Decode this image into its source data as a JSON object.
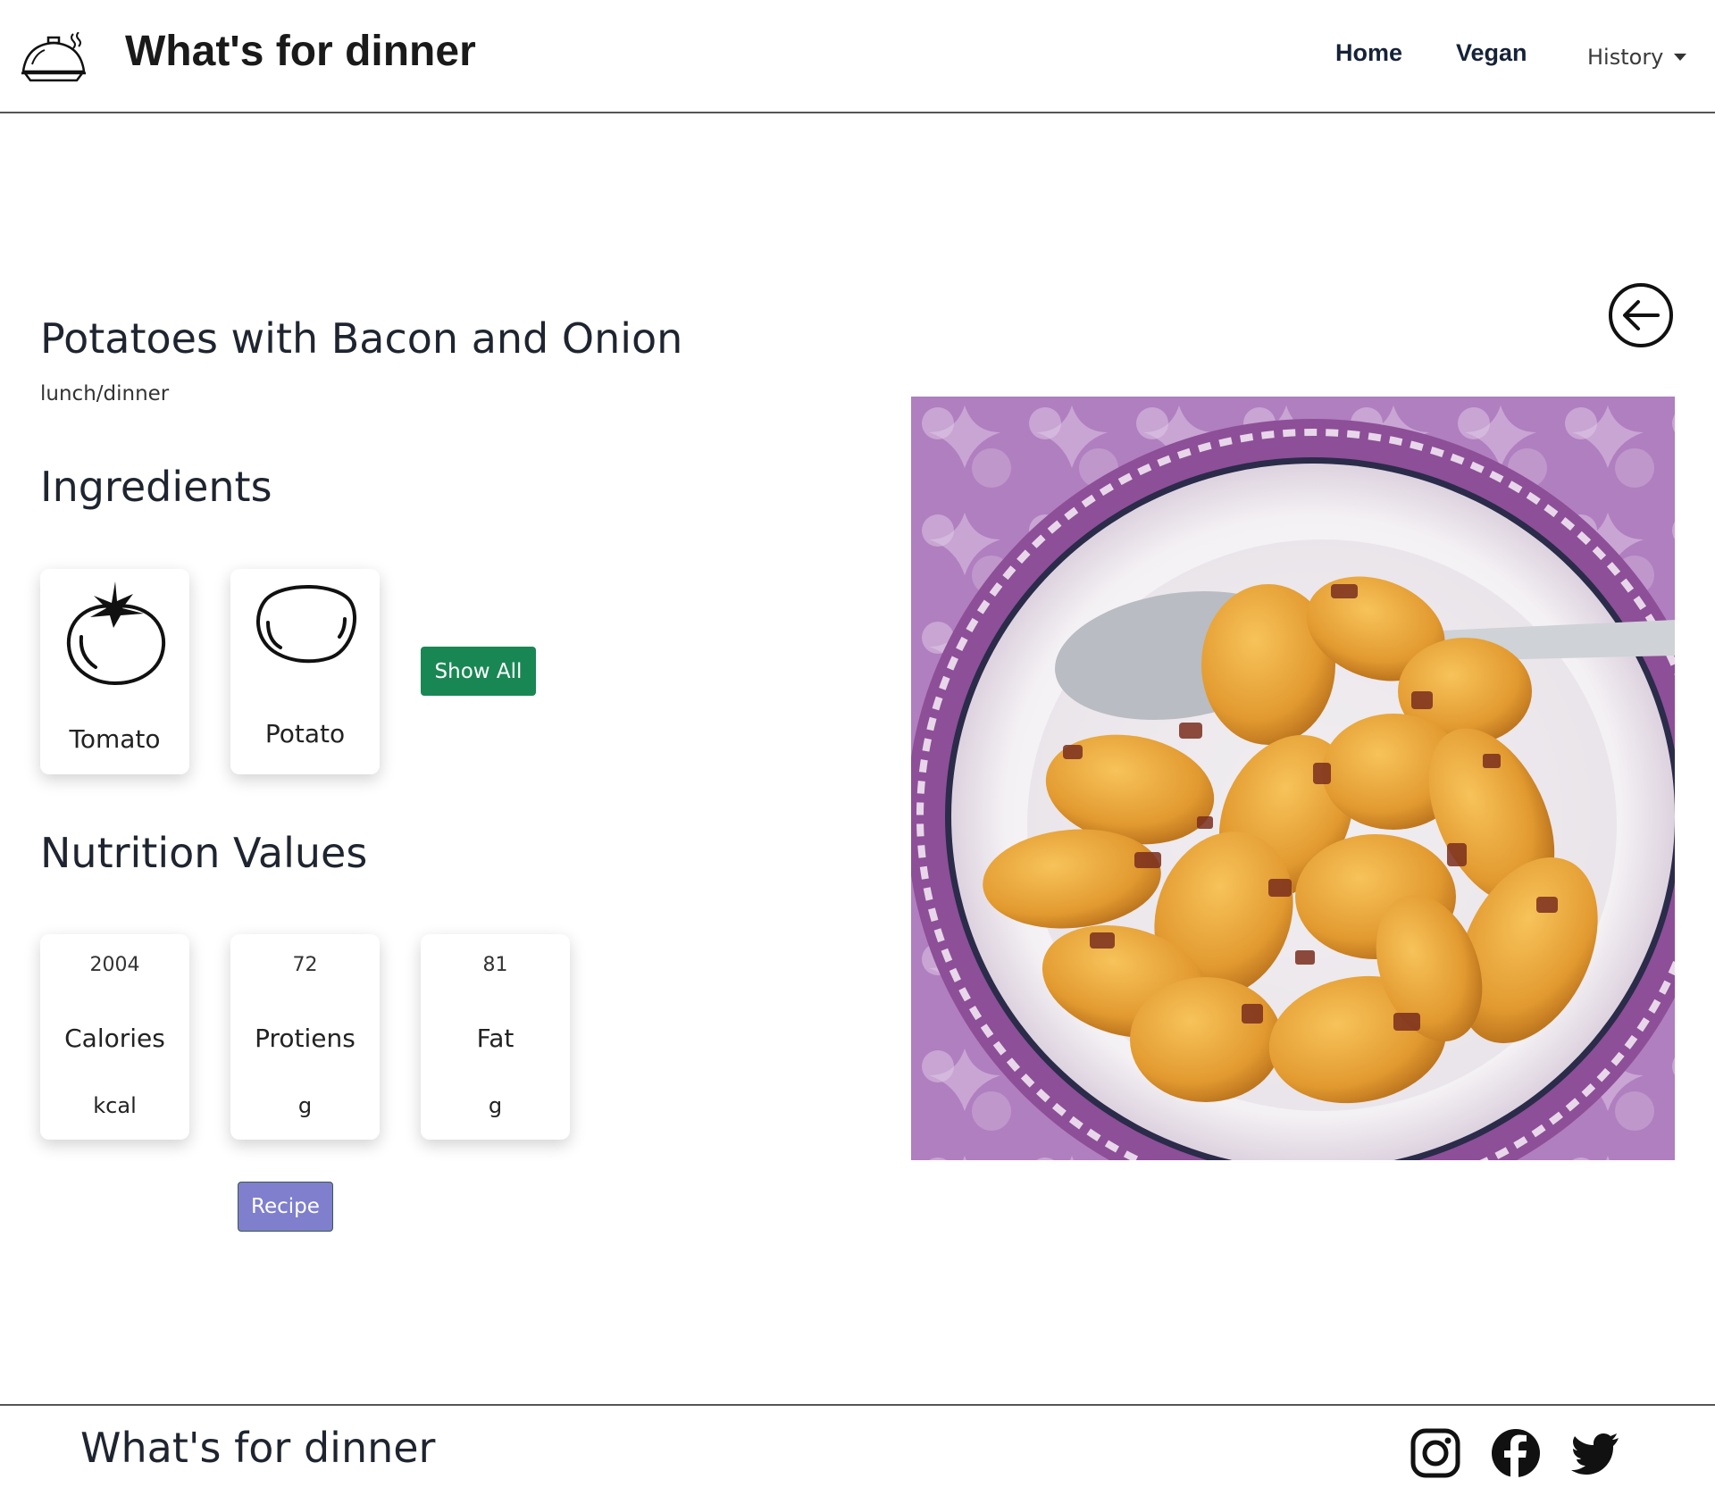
{
  "header": {
    "brand_title": "What's for dinner",
    "nav": {
      "home": "Home",
      "vegan": "Vegan",
      "history": "History"
    }
  },
  "recipe": {
    "title": "Potatoes with Bacon and Onion",
    "meal_type": "lunch/dinner",
    "ingredients_heading": "Ingredients",
    "ingredients": [
      {
        "name": "Tomato",
        "icon": "tomato-icon"
      },
      {
        "name": "Potato",
        "icon": "potato-icon"
      }
    ],
    "show_all_label": "Show All",
    "nutrition_heading": "Nutrition Values",
    "nutrition": [
      {
        "value": "2004",
        "label": "Calories",
        "unit": "kcal"
      },
      {
        "value": "72",
        "label": "Protiens",
        "unit": "g"
      },
      {
        "value": "81",
        "label": "Fat",
        "unit": "g"
      }
    ],
    "recipe_button_label": "Recipe"
  },
  "footer": {
    "title": "What's for dinner",
    "social": [
      "instagram-icon",
      "facebook-icon",
      "twitter-icon"
    ]
  },
  "colors": {
    "show_all_button": "#198754",
    "recipe_button": "#7f7fce",
    "nav_link": "#152238"
  }
}
